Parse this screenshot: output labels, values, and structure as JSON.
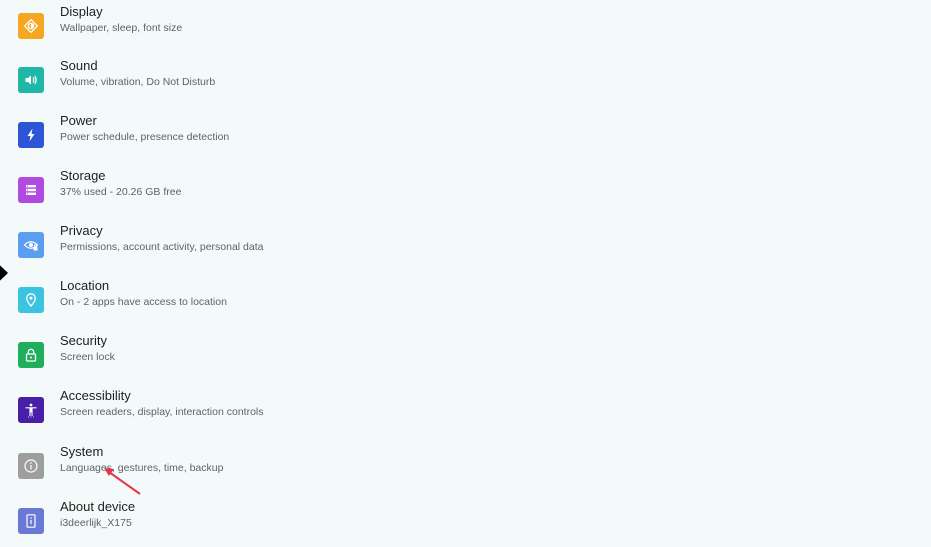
{
  "items": [
    {
      "id": "display",
      "title": "Display",
      "subtitle": "Wallpaper, sleep, font size",
      "icon": "brightness-icon",
      "color": "#f5a623"
    },
    {
      "id": "sound",
      "title": "Sound",
      "subtitle": "Volume, vibration, Do Not Disturb",
      "icon": "volume-icon",
      "color": "#1fb8a8"
    },
    {
      "id": "power",
      "title": "Power",
      "subtitle": "Power schedule, presence detection",
      "icon": "bolt-icon",
      "color": "#2c56d6"
    },
    {
      "id": "storage",
      "title": "Storage",
      "subtitle": "37% used - 20.26 GB free",
      "icon": "storage-icon",
      "color": "#b04ae0"
    },
    {
      "id": "privacy",
      "title": "Privacy",
      "subtitle": "Permissions, account activity, personal data",
      "icon": "privacy-eye-icon",
      "color": "#5b9df0"
    },
    {
      "id": "location",
      "title": "Location",
      "subtitle": "On - 2 apps have access to location",
      "icon": "location-pin-icon",
      "color": "#3cc3e0"
    },
    {
      "id": "security",
      "title": "Security",
      "subtitle": "Screen lock",
      "icon": "lock-icon",
      "color": "#1fae5c"
    },
    {
      "id": "accessibility",
      "title": "Accessibility",
      "subtitle": "Screen readers, display, interaction controls",
      "icon": "accessibility-icon",
      "color": "#4a1fa8"
    },
    {
      "id": "system",
      "title": "System",
      "subtitle": "Languages, gestures, time, backup",
      "icon": "info-icon",
      "color": "#9e9e9e"
    },
    {
      "id": "about",
      "title": "About device",
      "subtitle": "i3deerlijk_X175",
      "icon": "device-icon",
      "color": "#6a79d6"
    }
  ]
}
